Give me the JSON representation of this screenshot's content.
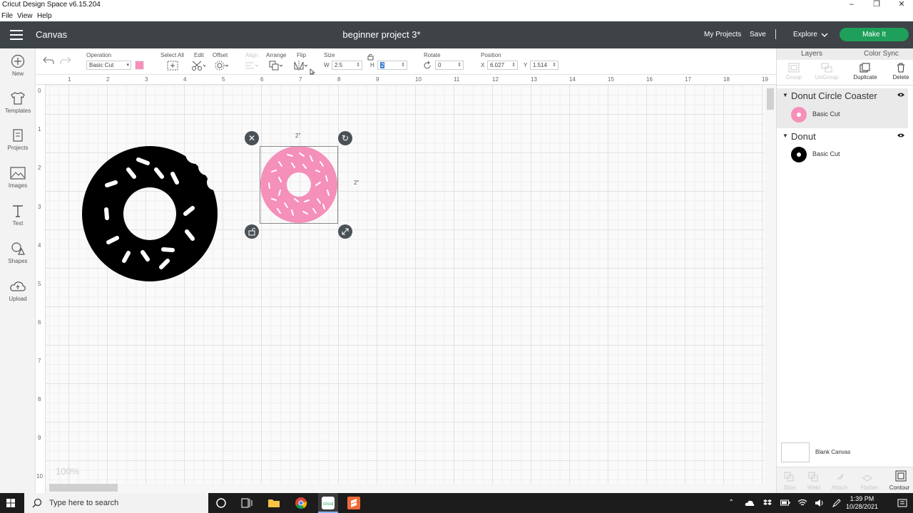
{
  "window": {
    "title": "Cricut Design Space  v6.15.204",
    "menu": [
      "File",
      "View",
      "Help"
    ]
  },
  "header": {
    "section": "Canvas",
    "project_title": "beginner project 3*",
    "my_projects": "My Projects",
    "save": "Save",
    "separator": "|",
    "explore": "Explore",
    "make_it": "Make It",
    "make_it_color": "#1fa05a"
  },
  "left_tools": [
    {
      "label": "New",
      "icon": "plus-circle-icon"
    },
    {
      "label": "Templates",
      "icon": "shirt-icon"
    },
    {
      "label": "Projects",
      "icon": "projects-icon"
    },
    {
      "label": "Images",
      "icon": "image-icon"
    },
    {
      "label": "Text",
      "icon": "text-icon"
    },
    {
      "label": "Shapes",
      "icon": "shapes-icon"
    },
    {
      "label": "Upload",
      "icon": "cloud-upload-icon"
    }
  ],
  "toolbar": {
    "operation_label": "Operation",
    "operation_value": "Basic Cut",
    "operation_color": "#f590ba",
    "select_all": "Select All",
    "edit": "Edit",
    "offset": "Offset",
    "align": "Align",
    "arrange": "Arrange",
    "flip": "Flip",
    "size": "Size",
    "w_label": "W",
    "w_value": "2.5",
    "h_label": "H",
    "h_value": "2",
    "rotate": "Rotate",
    "rotate_value": "0",
    "position": "Position",
    "x_label": "X",
    "x_value": "6.027",
    "y_label": "Y",
    "y_value": "1.514"
  },
  "ruler": {
    "top": [
      "1",
      "2",
      "3",
      "4",
      "5",
      "6",
      "7",
      "8",
      "9",
      "10",
      "11",
      "12",
      "13",
      "14",
      "15",
      "16",
      "17",
      "18",
      "19"
    ],
    "left": [
      "0",
      "1",
      "2",
      "3",
      "4",
      "5",
      "6",
      "7",
      "8",
      "9",
      "10"
    ]
  },
  "canvas": {
    "zoom": "100%",
    "selection_width_label": "2\"",
    "selection_height_label": "2\""
  },
  "panel": {
    "tabs": [
      "Layers",
      "Color Sync"
    ],
    "actions": [
      {
        "label": "Group",
        "enabled": false
      },
      {
        "label": "UnGroup",
        "enabled": false
      },
      {
        "label": "Duplicate",
        "enabled": true
      },
      {
        "label": "Delete",
        "enabled": true
      }
    ],
    "layers": [
      {
        "group": "Donut Circle Coaster",
        "item": "Basic Cut",
        "color": "#f590ba"
      },
      {
        "group": "Donut",
        "item": "Basic Cut",
        "color": "#000000"
      }
    ],
    "blank_canvas": "Blank Canvas",
    "bottom_actions": [
      {
        "label": "Slice",
        "enabled": false
      },
      {
        "label": "Weld",
        "enabled": false
      },
      {
        "label": "Attach",
        "enabled": false
      },
      {
        "label": "Flatten",
        "enabled": false
      },
      {
        "label": "Contour",
        "enabled": true
      }
    ]
  },
  "taskbar": {
    "search_placeholder": "Type here to search",
    "time": "1:39 PM",
    "date": "10/28/2021"
  }
}
